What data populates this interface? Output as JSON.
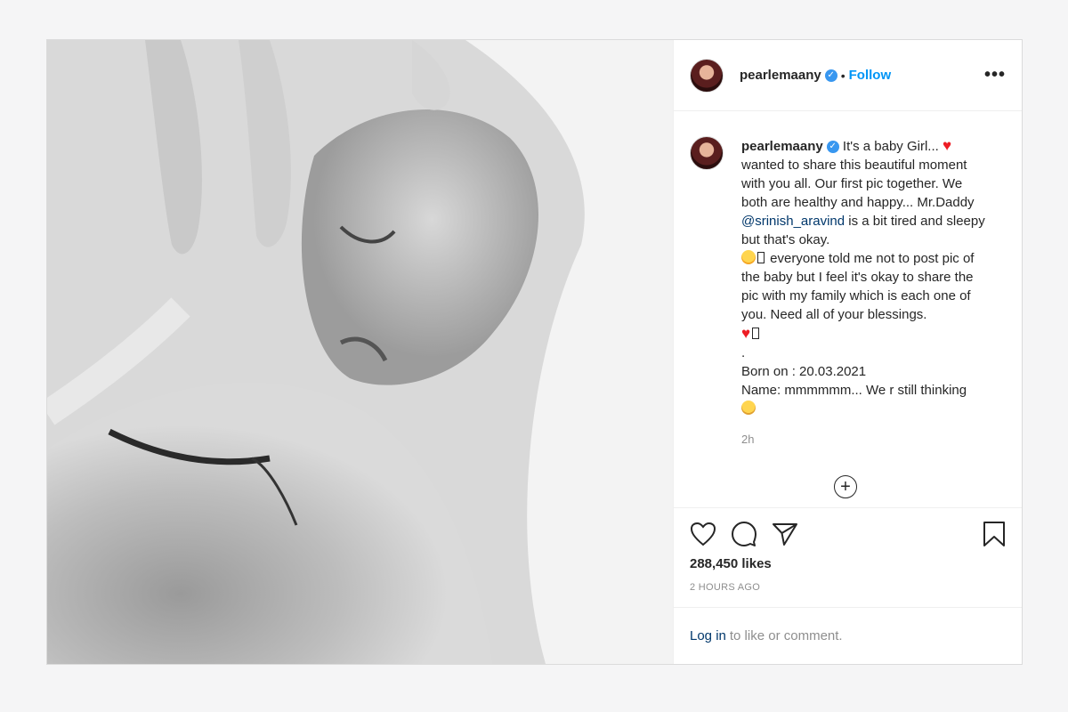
{
  "profile": {
    "username": "pearlemaany",
    "follow_label": "Follow",
    "separator": "•",
    "more_label": "•••"
  },
  "caption": {
    "username": "pearlemaany",
    "text_1": "It's a baby Girl...",
    "text_2": "wanted to share this beautiful moment with you all. Our first pic together. We both are healthy and happy... Mr.Daddy",
    "mention": "@srinish_aravind",
    "text_3": "is a bit tired and sleepy but that's okay.",
    "text_4": "everyone told me not to post pic of the baby but I feel it's okay to share the pic with my family which is each one of you. Need all of your blessings.",
    "dot_line": ".",
    "born": "Born on : 20.03.2021",
    "name_line": "Name: mmmmmm... We r still thinking",
    "time_ago": "2h"
  },
  "stats": {
    "likes": "288,450 likes",
    "posted": "2 HOURS AGO"
  },
  "login": {
    "link": "Log in",
    "text": "to like or comment."
  },
  "icons": {
    "like": "heart-outline-icon",
    "comment": "comment-bubble-icon",
    "share": "paper-plane-icon",
    "save": "bookmark-icon",
    "more": "plus-circle-icon"
  },
  "colors": {
    "link": "#00376b",
    "follow": "#0095f6",
    "verified": "#3897f0",
    "heart": "#ed1c24"
  }
}
